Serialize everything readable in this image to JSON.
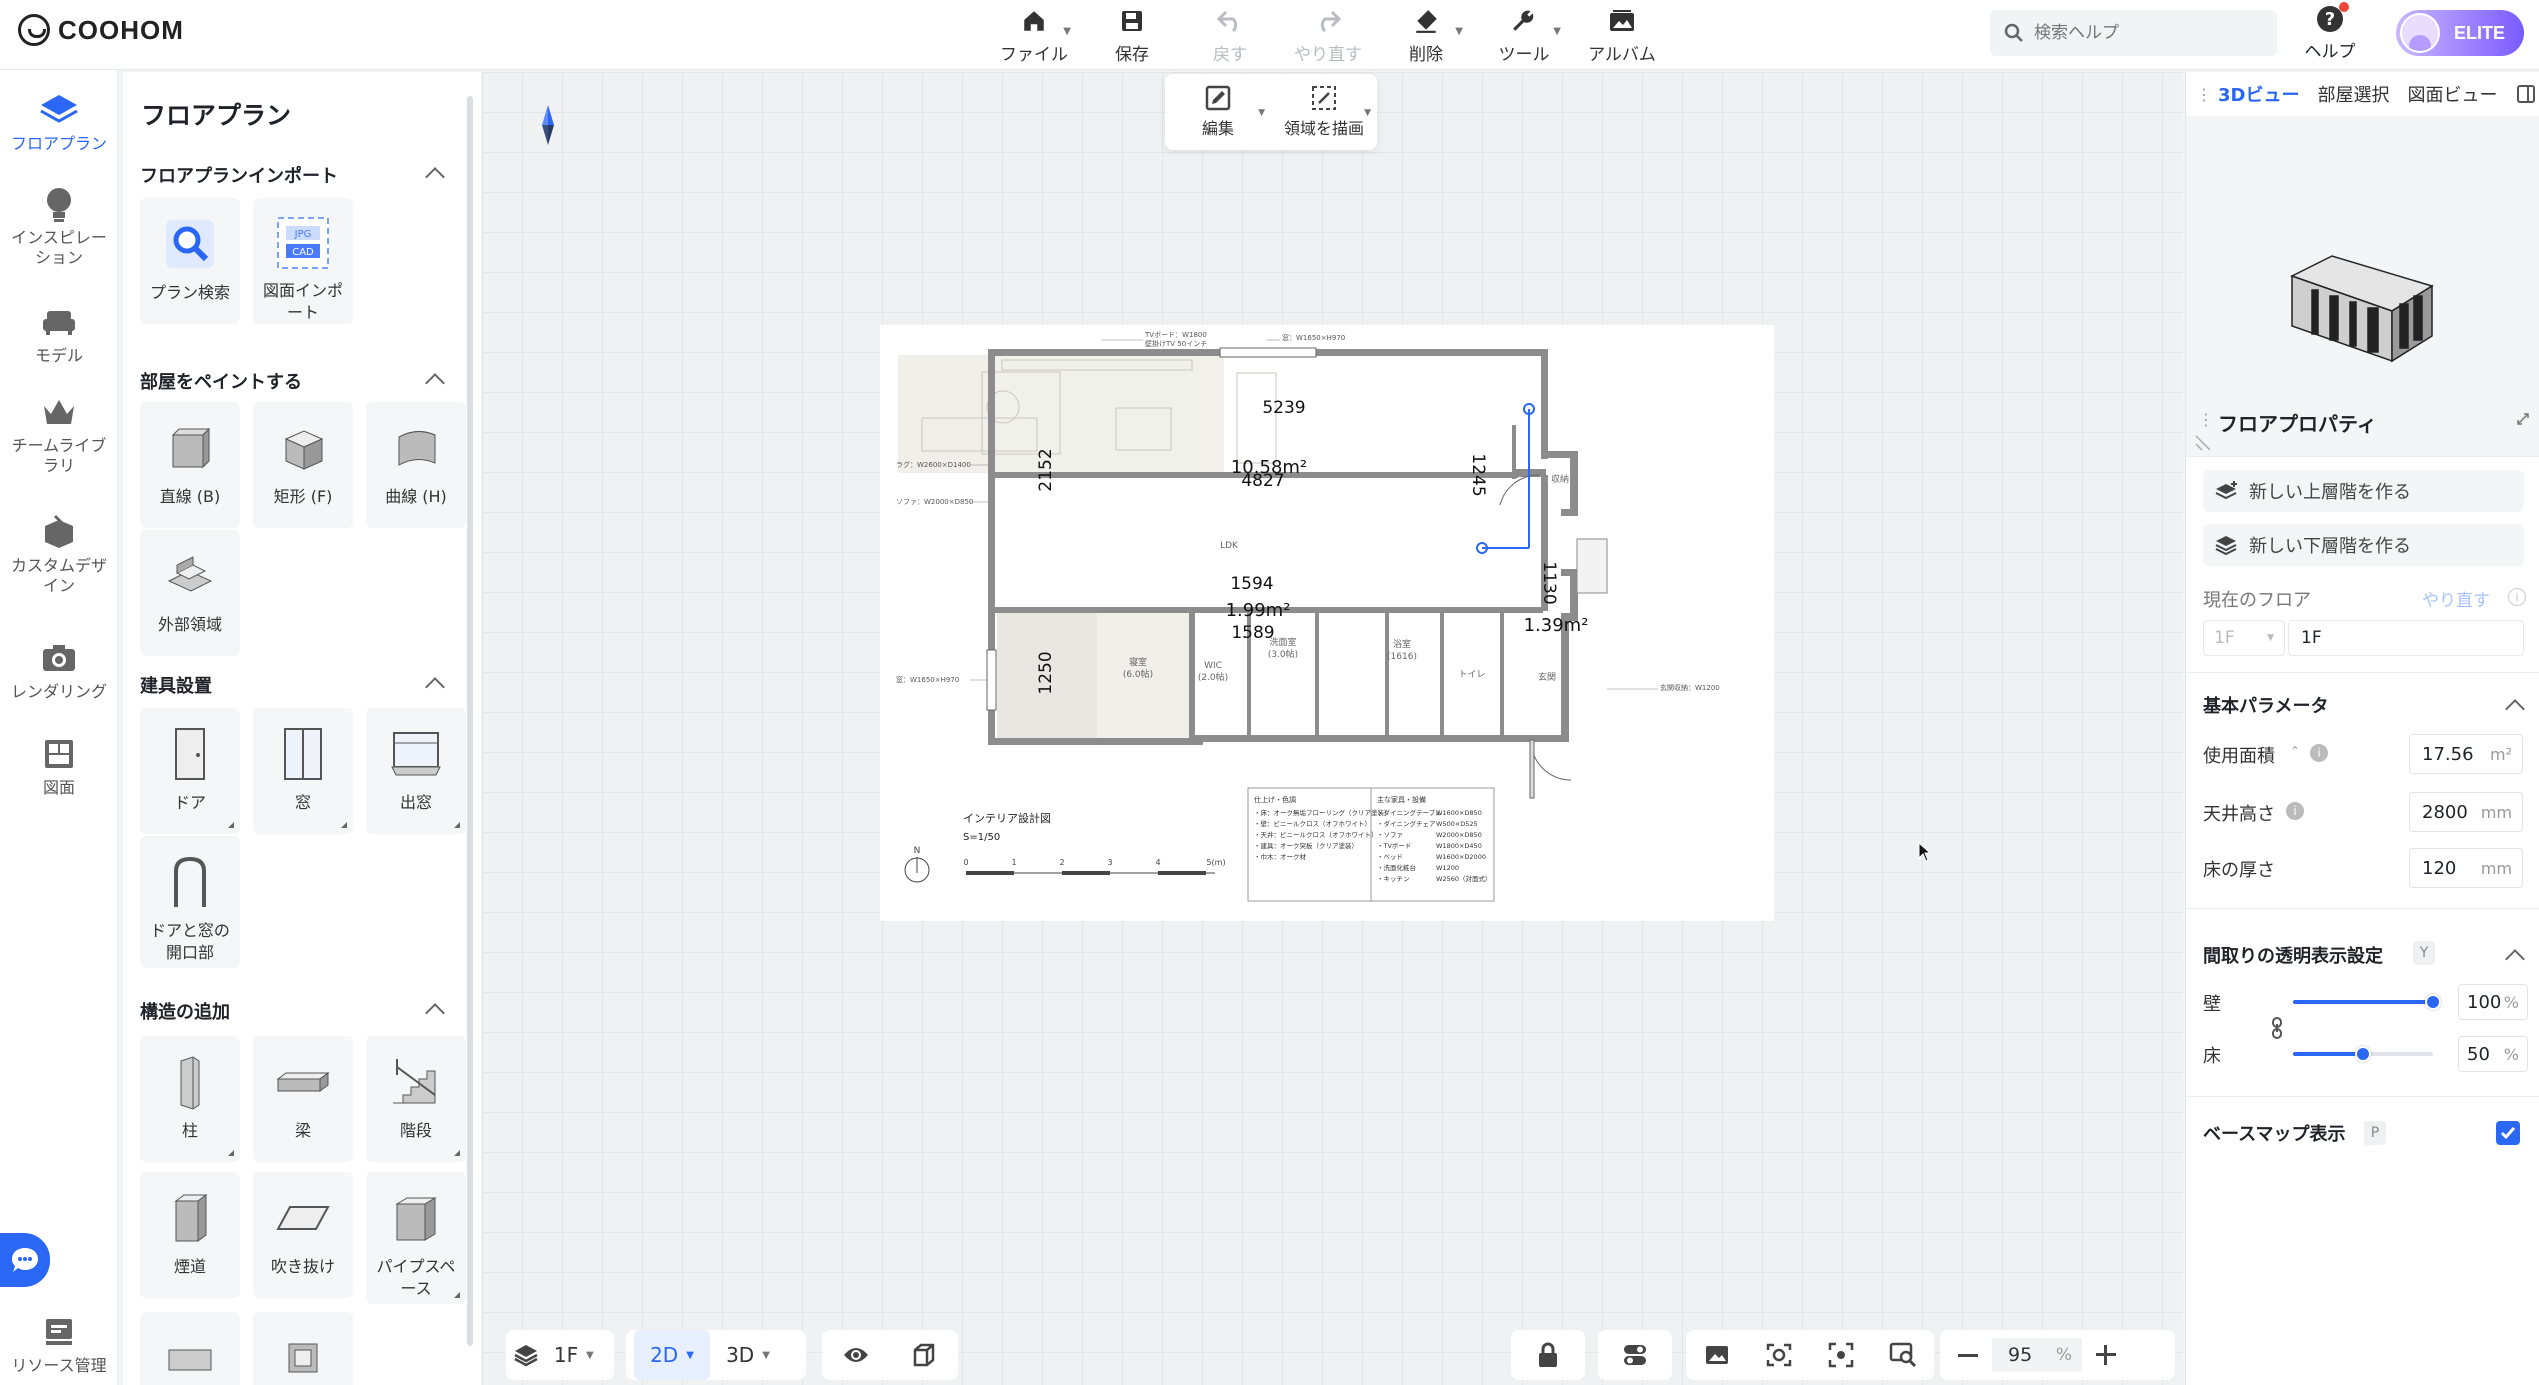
{
  "app": {
    "brand": "COOHOM"
  },
  "toolbar": {
    "file": "ファイル",
    "save": "保存",
    "undo": "戻す",
    "redo": "やり直す",
    "delete": "削除",
    "tools": "ツール",
    "album": "アルバム"
  },
  "search": {
    "placeholder": "検索ヘルプ"
  },
  "help": {
    "label": "ヘルプ"
  },
  "user": {
    "badge": "ELITE"
  },
  "rail": {
    "floorplan": "フロアプラン",
    "inspiration": "インスピレーション",
    "model": "モデル",
    "team_library": "チームライブラリ",
    "custom_design": "カスタムデザイン",
    "rendering": "レンダリング",
    "drawing": "図面",
    "resource": "リソース管理"
  },
  "panel": {
    "title": "フロアプラン",
    "import_section": "フロアプランインポート",
    "plan_search": "プラン検索",
    "drawing_import": "図面インポート",
    "paint_section": "部屋をペイントする",
    "line": "直線 (B)",
    "rect": "矩形 (F)",
    "curve": "曲線 (H)",
    "outer_area": "外部領域",
    "fixtures_section": "建具設置",
    "door": "ドア",
    "window": "窓",
    "bay_window": "出窓",
    "opening": "ドアと窓の開口部",
    "structure_section": "構造の追加",
    "column": "柱",
    "beam": "梁",
    "stairs": "階段",
    "chimney": "煙道",
    "void": "吹き抜け",
    "pipe_space": "パイプスペース"
  },
  "edit_popup": {
    "edit": "編集",
    "draw_area": "領域を描画"
  },
  "plan": {
    "dim_top": "5239",
    "area_ldk": "10.58m²",
    "dim_mid": "4827",
    "dim_left": "2152",
    "dim_right": "1245",
    "dim_1130": "1130",
    "area_entry": "1.39m²",
    "dim_bed_top": "1594",
    "area_bed": "1.99m²",
    "dim_bed_bot": "1589",
    "dim_bed_left": "1250",
    "note_top1": "TVボード：W1800",
    "note_top2": "壁掛けTV 50インチ",
    "note_window": "窓：W1650×H970",
    "note_rug": "ラグ：W2600×D1400",
    "note_sofa": "ソファ：W2000×D850",
    "note_window2": "窓：W1650×H970",
    "note_storage": "玄関収納：W1200",
    "label_ldk": "LDK",
    "label_storage": "収納",
    "label_wic": "WIC",
    "label_wic_sub": "(2.0帖)",
    "label_wash": "洗面室",
    "label_wash_sub": "(3.0帖)",
    "label_bath": "浴室",
    "label_bath_sub": "(1616)",
    "label_toilet": "トイレ",
    "label_entry": "玄関",
    "label_bed": "寝室",
    "label_bed_sub": "(6.0帖)",
    "title": "インテリア設計図",
    "scale": "S=1/50",
    "north": "N",
    "scale_ticks": [
      "0",
      "1",
      "2",
      "3",
      "4",
      "5(m)"
    ],
    "finish_title": "仕上げ・色調",
    "finish_lines": [
      "・床：オーク無垢フローリング（クリア塗装）",
      "・壁：ビニールクロス（オフホワイト）",
      "・天井：ビニールクロス（オフホワイト）",
      "・建具：オーク突板（クリア塗装）",
      "・巾木：オーク材"
    ],
    "furniture_title": "主な家具・設備",
    "furniture_names": [
      "・ダイニングテーブル",
      "・ダイニングチェア",
      "・ソファ",
      "・TVボード",
      "・ベッド",
      "・洗面化粧台",
      "・キッチン"
    ],
    "furniture_sizes": [
      "W1600×D850",
      "W500×D525",
      "W2000×D850",
      "W1800×D450",
      "W1600×D2000",
      "W1200",
      "W2560（対面式）"
    ]
  },
  "bottom": {
    "floor": "1F",
    "mode_2d": "2D",
    "mode_3d": "3D",
    "zoom": "95",
    "zoom_unit": "%"
  },
  "right": {
    "tab_3d": "3Dビュー",
    "tab_room": "部屋選択",
    "tab_plan": "図面ビュー",
    "props_title": "フロアプロパティ",
    "new_upper": "新しい上層階を作る",
    "new_lower": "新しい下層階を作る",
    "current_floor": "現在のフロア",
    "redo": "やり直す",
    "floor_select": "1F",
    "floor_name": "1F",
    "basic_params": "基本パラメータ",
    "usable_area": "使用面積",
    "usable_area_val": "17.56",
    "usable_area_unit": "m²",
    "ceiling_height": "天井高さ",
    "ceiling_height_val": "2800",
    "ceiling_unit": "mm",
    "floor_thickness": "床の厚さ",
    "floor_thickness_val": "120",
    "floor_thickness_unit": "mm",
    "transparency": "間取りの透明表示設定",
    "transparency_key": "Y",
    "wall": "壁",
    "wall_val": "100",
    "floor": "床",
    "floor_val": "50",
    "pct": "%",
    "basemap": "ベースマップ表示",
    "basemap_key": "P",
    "wall_level": 1.0,
    "floor_level": 0.5
  },
  "colors": {
    "accent": "#2a67f5",
    "wall": "#8a8a8a"
  }
}
